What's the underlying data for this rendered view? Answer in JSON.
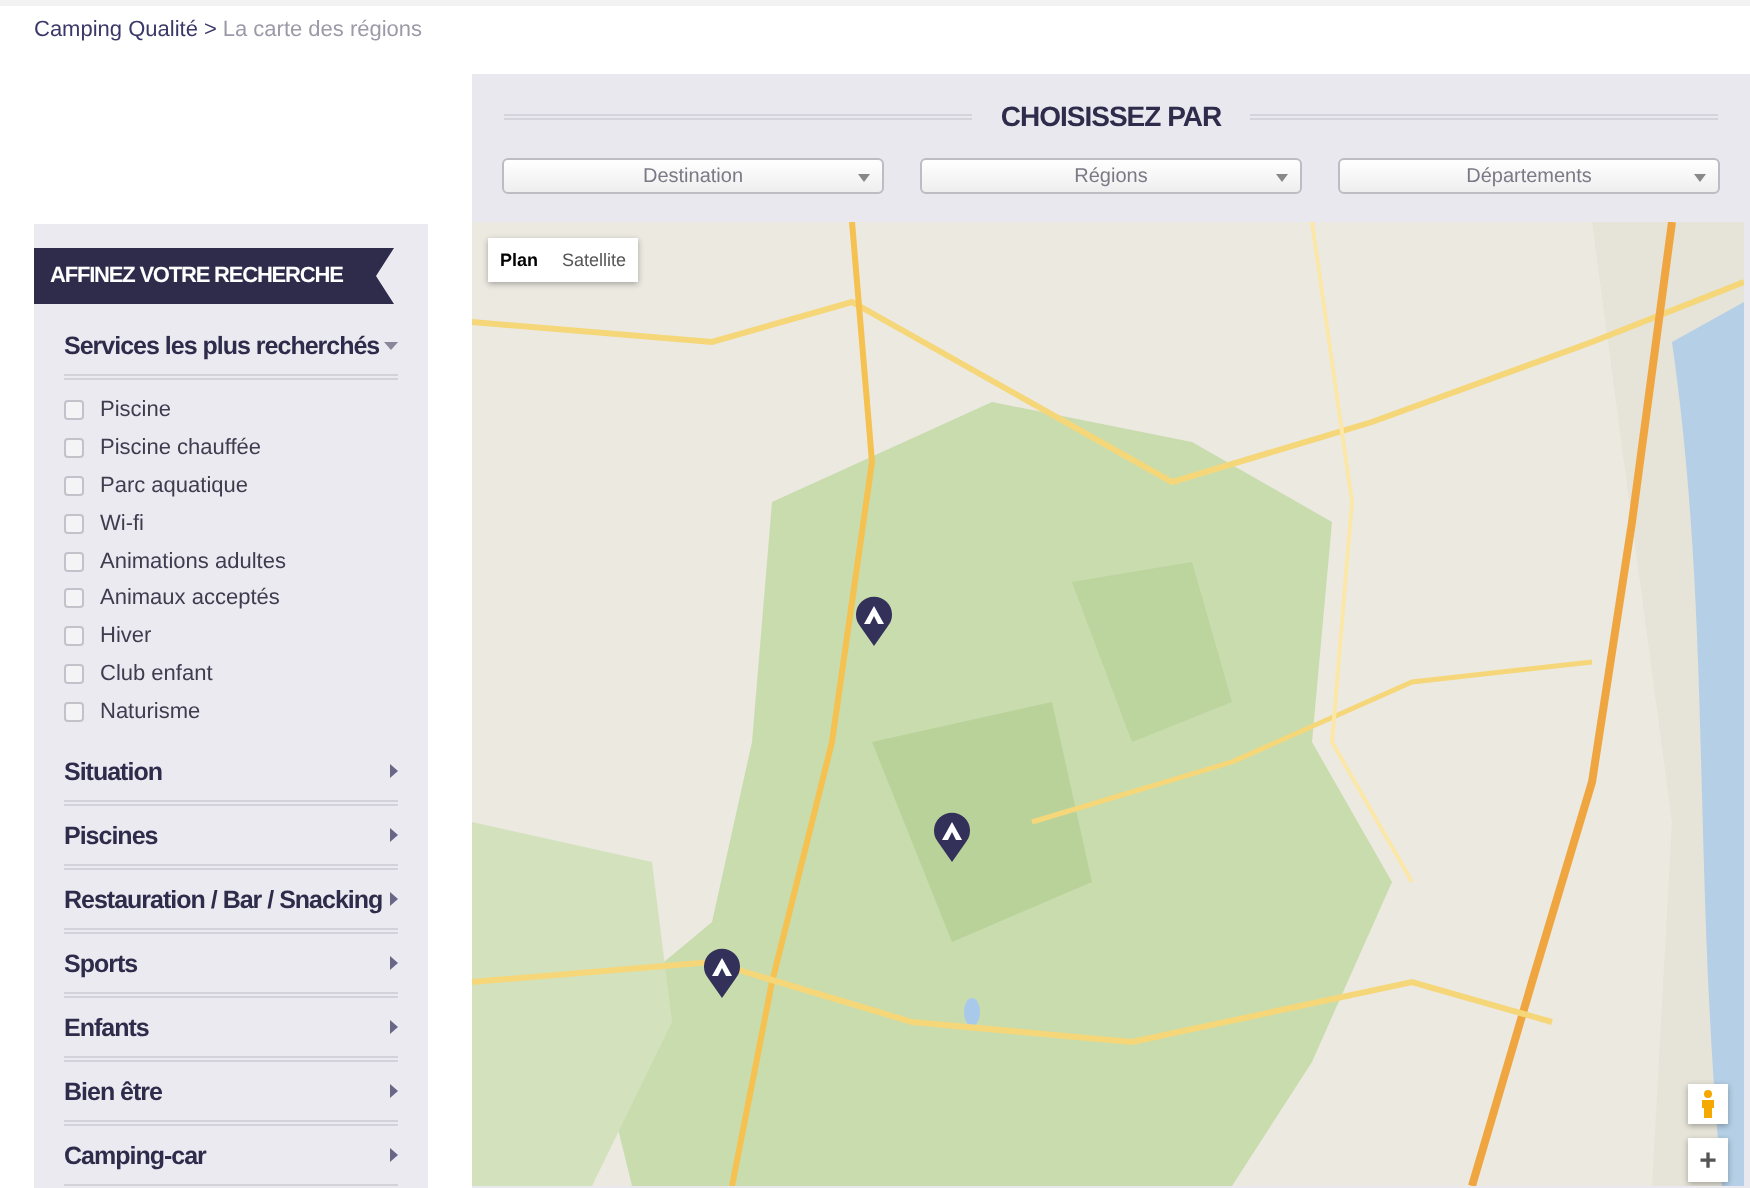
{
  "breadcrumb": {
    "links": [
      {
        "label": "Camping Qualité"
      }
    ],
    "separator": ">",
    "current": "La carte des régions"
  },
  "sidebar": {
    "title": "AFFINEZ VOTRE RECHERCHE",
    "sections": [
      {
        "label": "Services les plus recherchés",
        "expanded": true,
        "options": [
          {
            "label": "Piscine",
            "checked": false
          },
          {
            "label": "Piscine chauffée",
            "checked": false
          },
          {
            "label": "Parc aquatique",
            "checked": false
          },
          {
            "label": "Wi-fi",
            "checked": false
          },
          {
            "label": "Animations adultes",
            "checked": false
          },
          {
            "label": "Animaux acceptés",
            "checked": false
          },
          {
            "label": "Hiver",
            "checked": false
          },
          {
            "label": "Club enfant",
            "checked": false
          },
          {
            "label": "Naturisme",
            "checked": false
          }
        ]
      },
      {
        "label": "Situation",
        "expanded": false
      },
      {
        "label": "Piscines",
        "expanded": false
      },
      {
        "label": "Restauration / Bar / Snacking",
        "expanded": false
      },
      {
        "label": "Sports",
        "expanded": false
      },
      {
        "label": "Enfants",
        "expanded": false
      },
      {
        "label": "Bien être",
        "expanded": false
      },
      {
        "label": "Camping-car",
        "expanded": false
      }
    ]
  },
  "chooser": {
    "title": "CHOISISSEZ PAR",
    "selects": [
      {
        "label": "Destination"
      },
      {
        "label": "Régions"
      },
      {
        "label": "Départements"
      }
    ]
  },
  "map": {
    "kind": "picture",
    "map_types": [
      {
        "label": "Plan",
        "selected": true
      },
      {
        "label": "Satellite",
        "selected": false
      }
    ],
    "zoom_in": "+"
  }
}
